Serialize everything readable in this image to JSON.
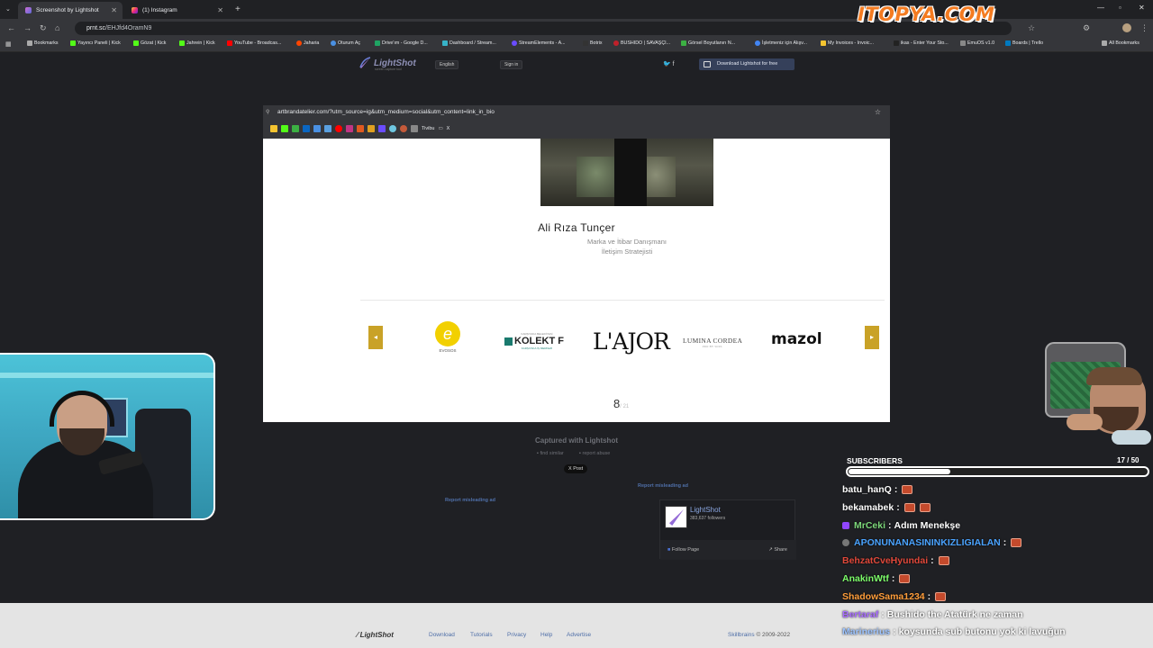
{
  "browser": {
    "tabs": [
      {
        "title": "Screenshot by Lightshot",
        "active": true
      },
      {
        "title": "(1) Instagram",
        "active": false
      }
    ],
    "url_host": "prnt.sc",
    "url_path": "/EHJfd4OramN9",
    "bookmarks": [
      "Bookmarks",
      "Yayıncı Paneli | Kick",
      "Gözat | Kick",
      "Jahrein | Kick",
      "YouTube - Broadcas...",
      "Jaharia",
      "Oturum Aç",
      "Drive'ım - Google D...",
      "Dashboard / Stream...",
      "StreamElements - A...",
      "Botrix",
      "BUSHIDO | SAVAŞÇI...",
      "Görsel Boyutlanırı N...",
      "İşletmeniz için Alışv...",
      "My Invoices - Invoic...",
      "ikas - Enter Your Sto...",
      "EmuOS v1.0",
      "Boards | Trello",
      "All Bookmarks"
    ]
  },
  "overlay_logo": "ITOPYA.COM",
  "lightshot": {
    "logo": "LightShot",
    "tagline": "screen capture tool",
    "language": "English",
    "signin": "Sign in",
    "social": "🐦 f",
    "download": "Download Lightshot for free",
    "captured": "Captured with Lightshot",
    "find_similar": "find similar",
    "report_abuse": "report abuse",
    "xpost": "X Post",
    "report_ad_1": "Report misleading ad",
    "report_ad_2": "Report misleading ad",
    "fb_name": "LightShot",
    "fb_followers": "383,637 followers",
    "fb_follow": "Follow Page",
    "fb_share": "Share",
    "footer_logo": "LightShot",
    "footer_links": [
      "Download",
      "Tutorials",
      "Privacy",
      "Help",
      "Advertise"
    ],
    "footer_copy_link": "Skillbrains",
    "footer_copy": "© 2009-2022"
  },
  "screenshot": {
    "url": "artbrandatelier.com/?utm_source=ig&utm_medium=social&utm_content=link_in_bio",
    "bm_label_1": "Tivibu",
    "bm_label_2": "X",
    "person_name": "Ali Rıza Tunçer",
    "role_1": "Marka ve İtibar Danışmanı",
    "role_2": "İletişim Stratejisti",
    "brands": {
      "evosos": "EVOSOS",
      "kolekt_top": "KARŞIYAKA BELEDİYESİ",
      "kolekt": "KOLEKT F",
      "kolekt_sub": "KARŞIYAKA İŞ MERKEZİ",
      "lajor": "L'AJOR",
      "lumina": "LUMINA CORDEA",
      "lumina_sub": "PRO BY SOUL",
      "mazol": "mazol"
    },
    "page": "8",
    "page_total": "/ 21"
  },
  "subscribers": {
    "label": "SUBSCRIBERS",
    "count_text": "17 / 50",
    "current": 17,
    "goal": 50
  },
  "chat": [
    {
      "user": "batu_hanQ",
      "color": "#ffffff",
      "message": "",
      "emotes": 1
    },
    {
      "user": "bekamabek",
      "color": "#ffffff",
      "message": "",
      "emotes": 2
    },
    {
      "user": "MrCeki",
      "color": "#7dd87a",
      "message": "Adım Menekşe",
      "emotes": 0,
      "badge": "purple"
    },
    {
      "user": "APONUNANASININKIZLIGIALAN",
      "color": "#4aa3ff",
      "message": "",
      "emotes": 1,
      "badge": "gray"
    },
    {
      "user": "BehzatCveHyundai",
      "color": "#e0483a",
      "message": "",
      "emotes": 1
    },
    {
      "user": "AnakinWtf",
      "color": "#7dfd6a",
      "message": "",
      "emotes": 1
    },
    {
      "user": "ShadowSama1234",
      "color": "#ff9d3a",
      "message": "",
      "emotes": 1
    },
    {
      "user": "Bertaraf",
      "color": "#a86cff",
      "message": "Bushido the Atatürk ne zaman",
      "emotes": 0
    },
    {
      "user": "Marinerius",
      "color": "#9cc3ff",
      "message": "koysunda sub butonu yok ki lavuğun",
      "emotes": 0
    }
  ]
}
